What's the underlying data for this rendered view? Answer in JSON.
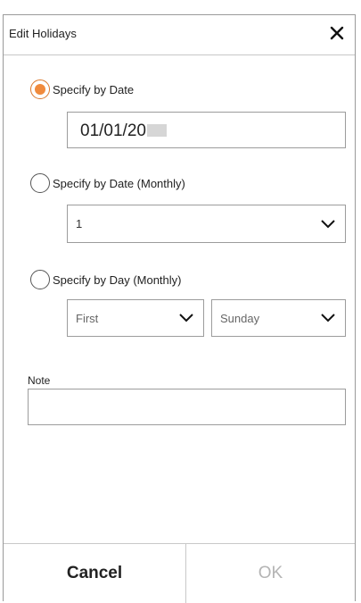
{
  "dialog": {
    "title": "Edit Holidays",
    "close_icon": "close-icon"
  },
  "options": {
    "by_date": {
      "label": "Specify by Date",
      "selected": true,
      "value": "01/01/20"
    },
    "by_date_monthly": {
      "label": "Specify by Date (Monthly)",
      "selected": false,
      "value": "1"
    },
    "by_day_monthly": {
      "label": "Specify by Day (Monthly)",
      "selected": false,
      "week_value": "First",
      "day_value": "Sunday"
    }
  },
  "note": {
    "label": "Note",
    "value": ""
  },
  "footer": {
    "cancel_label": "Cancel",
    "ok_label": "OK"
  },
  "colors": {
    "radio_accent": "#f08a3c",
    "ok_disabled": "#b4b4b4"
  }
}
